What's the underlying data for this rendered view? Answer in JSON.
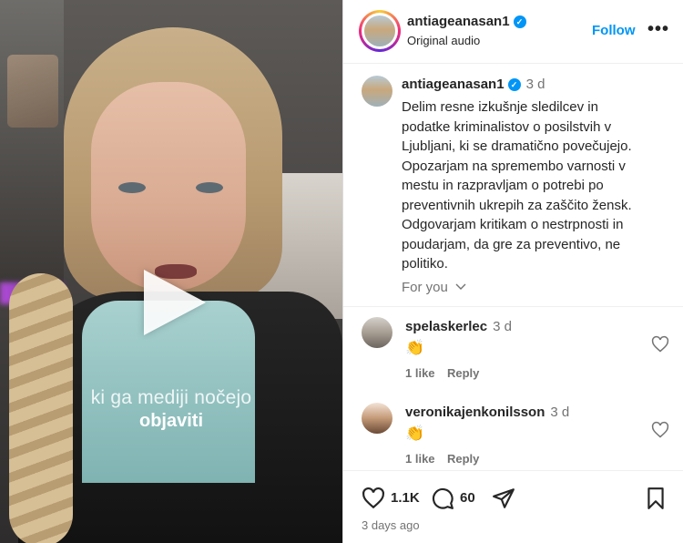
{
  "video": {
    "caption_line1": "ki ga mediji nočejo",
    "caption_line2": "objaviti"
  },
  "header": {
    "username": "antiageanasan1",
    "verified": true,
    "audio": "Original audio",
    "follow_label": "Follow",
    "more_label": "•••"
  },
  "post": {
    "username": "antiageanasan1",
    "time": "3 d",
    "text": "Delim resne izkušnje sledilcev in\npodatke kriminalistov o posilstvih v\nLjubljani, ki se dramatično povečujejo.\nOpozarjam na spremembo varnosti v\nmestu in razpravljam o potrebi po\npreventivnih ukrepih za zaščito žensk.\nOdgovarjam kritikam o nestrpnosti in\npoudarjam, da gre za preventivo, ne\npolitiko.",
    "for_you_label": "For you"
  },
  "comments": [
    {
      "username": "spelaskerlec",
      "time": "3 d",
      "text": "👏",
      "likes": "1 like",
      "reply_label": "Reply"
    },
    {
      "username": "veronikajenkonilsson",
      "time": "3 d",
      "text": "👏",
      "likes": "1 like",
      "reply_label": "Reply"
    }
  ],
  "actions": {
    "likes_count": "1.1K",
    "comments_count": "60",
    "posted_ago": "3 days ago"
  },
  "colors": {
    "accent": "#0095f6",
    "verified": "#0095f6",
    "muted_text": "#737373"
  }
}
